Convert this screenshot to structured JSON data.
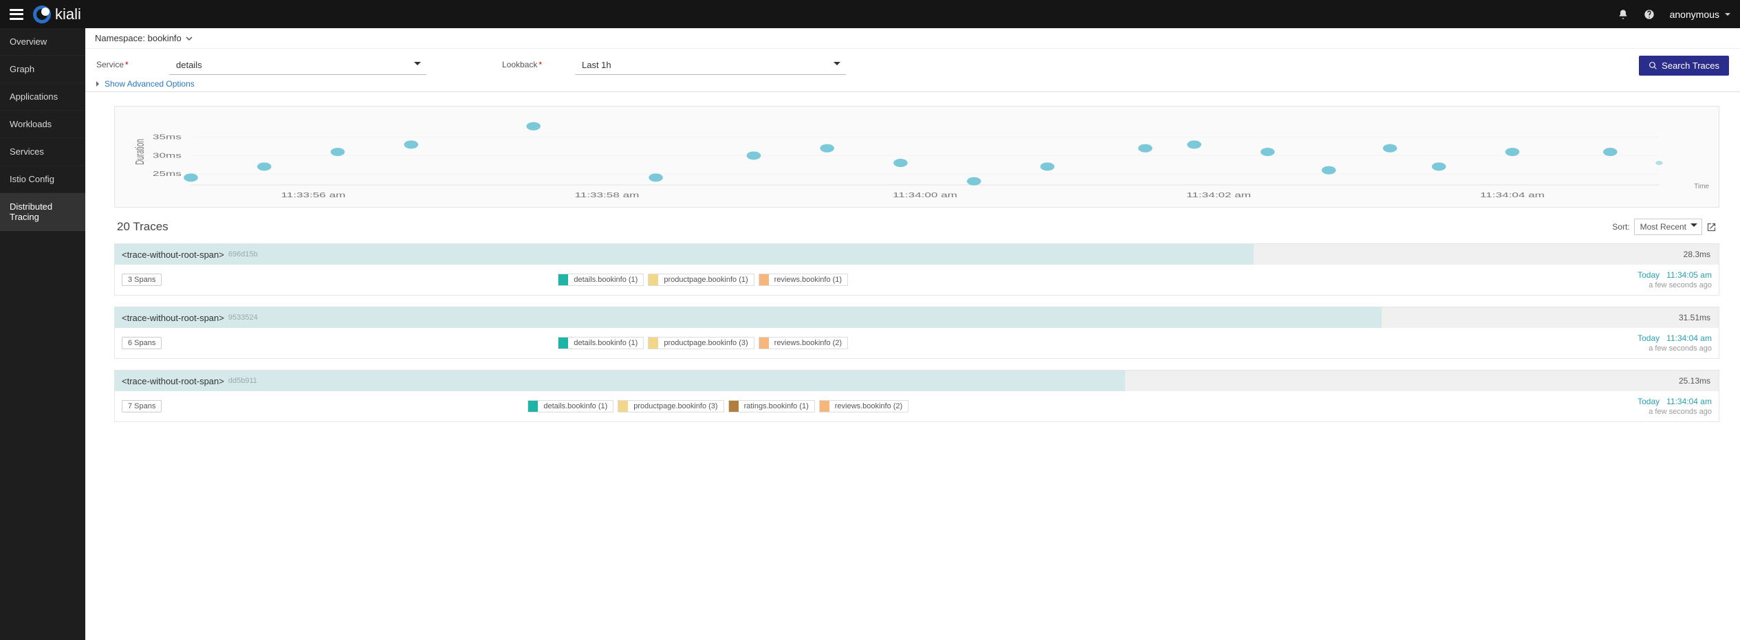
{
  "brand": "kiali",
  "user": "anonymous",
  "nav": {
    "items": [
      {
        "label": "Overview"
      },
      {
        "label": "Graph"
      },
      {
        "label": "Applications"
      },
      {
        "label": "Workloads"
      },
      {
        "label": "Services"
      },
      {
        "label": "Istio Config"
      },
      {
        "label": "Distributed Tracing"
      }
    ],
    "active_index": 6
  },
  "breadcrumb": {
    "label": "Namespace:",
    "value": "bookinfo"
  },
  "filters": {
    "service": {
      "label": "Service",
      "value": "details"
    },
    "lookback": {
      "label": "Lookback",
      "value": "Last 1h"
    },
    "advanced": "Show Advanced Options",
    "search_btn": "Search Traces"
  },
  "chart_data": {
    "type": "scatter",
    "ylabel": "Duration",
    "xlabel": "Time",
    "y_ticks": [
      "25ms",
      "30ms",
      "35ms"
    ],
    "x_ticks": [
      "11:33:56 am",
      "11:33:58 am",
      "11:34:00 am",
      "11:34:02 am",
      "11:34:04 am"
    ],
    "ylim": [
      22,
      40
    ],
    "points": [
      {
        "t": 0,
        "ms": 24
      },
      {
        "t": 6,
        "ms": 27
      },
      {
        "t": 12,
        "ms": 31
      },
      {
        "t": 18,
        "ms": 33
      },
      {
        "t": 28,
        "ms": 38
      },
      {
        "t": 38,
        "ms": 24
      },
      {
        "t": 46,
        "ms": 30
      },
      {
        "t": 52,
        "ms": 32
      },
      {
        "t": 58,
        "ms": 28
      },
      {
        "t": 64,
        "ms": 23
      },
      {
        "t": 70,
        "ms": 27
      },
      {
        "t": 78,
        "ms": 32
      },
      {
        "t": 82,
        "ms": 33
      },
      {
        "t": 88,
        "ms": 31
      },
      {
        "t": 93,
        "ms": 26
      },
      {
        "t": 98,
        "ms": 32
      },
      {
        "t": 102,
        "ms": 27
      },
      {
        "t": 108,
        "ms": 31
      },
      {
        "t": 116,
        "ms": 31
      },
      {
        "t": 120,
        "ms": 28,
        "small": true
      }
    ]
  },
  "results": {
    "count_label": "20 Traces",
    "sort_label": "Sort:",
    "sort_value": "Most Recent"
  },
  "svc_colors": {
    "details.bookinfo": "#1fb5a6",
    "productpage.bookinfo": "#f2d68a",
    "reviews.bookinfo": "#f5b77b",
    "ratings.bookinfo": "#b07f3d"
  },
  "traces": [
    {
      "name": "<trace-without-root-span>",
      "id": "696d15b",
      "duration": "28.3ms",
      "bar_pct": 71,
      "spans": "3 Spans",
      "services": [
        {
          "svc": "details.bookinfo",
          "label": "details.bookinfo (1)"
        },
        {
          "svc": "productpage.bookinfo",
          "label": "productpage.bookinfo (1)"
        },
        {
          "svc": "reviews.bookinfo",
          "label": "reviews.bookinfo (1)"
        }
      ],
      "day": "Today",
      "time": "11:34:05 am",
      "rel": "a few seconds ago"
    },
    {
      "name": "<trace-without-root-span>",
      "id": "9533524",
      "duration": "31.51ms",
      "bar_pct": 79,
      "spans": "6 Spans",
      "services": [
        {
          "svc": "details.bookinfo",
          "label": "details.bookinfo (1)"
        },
        {
          "svc": "productpage.bookinfo",
          "label": "productpage.bookinfo (3)"
        },
        {
          "svc": "reviews.bookinfo",
          "label": "reviews.bookinfo (2)"
        }
      ],
      "day": "Today",
      "time": "11:34:04 am",
      "rel": "a few seconds ago"
    },
    {
      "name": "<trace-without-root-span>",
      "id": "dd5b911",
      "duration": "25.13ms",
      "bar_pct": 63,
      "spans": "7 Spans",
      "services": [
        {
          "svc": "details.bookinfo",
          "label": "details.bookinfo (1)"
        },
        {
          "svc": "productpage.bookinfo",
          "label": "productpage.bookinfo (3)"
        },
        {
          "svc": "ratings.bookinfo",
          "label": "ratings.bookinfo (1)"
        },
        {
          "svc": "reviews.bookinfo",
          "label": "reviews.bookinfo (2)"
        }
      ],
      "day": "Today",
      "time": "11:34:04 am",
      "rel": "a few seconds ago"
    }
  ]
}
